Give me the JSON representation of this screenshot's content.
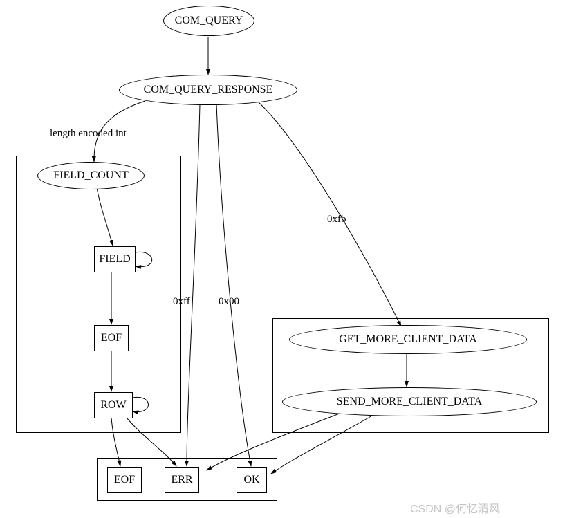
{
  "nodes": {
    "com_query": "COM_QUERY",
    "com_query_response": "COM_QUERY_RESPONSE",
    "field_count": "FIELD_COUNT",
    "field": "FIELD",
    "eof1": "EOF",
    "row": "ROW",
    "get_more": "GET_MORE_CLIENT_DATA",
    "send_more": "SEND_MORE_CLIENT_DATA",
    "eof2": "EOF",
    "err": "ERR",
    "ok": "OK"
  },
  "edge_labels": {
    "len_enc": "length encoded int",
    "xfb": "0xfb",
    "xff": "0xff",
    "x00": "0x00"
  },
  "watermark": "CSDN @何忆清风"
}
